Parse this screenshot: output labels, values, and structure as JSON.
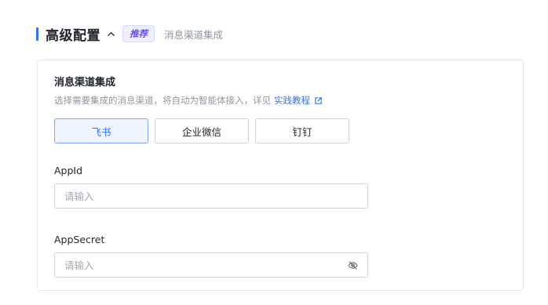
{
  "header": {
    "title": "高级配置",
    "badge": "推荐",
    "subtitle": "消息渠道集成",
    "accent_color": "#3370ff",
    "collapse_icon": "chevron-up-icon"
  },
  "card": {
    "title": "消息渠道集成",
    "description": "选择需要集成的消息渠道，将自动为智能体接入，详见",
    "link_text": "实践教程",
    "link_icon": "external-link-icon",
    "link_color": "#3370ff"
  },
  "channels": [
    {
      "label": "飞书",
      "selected": true
    },
    {
      "label": "企业微信",
      "selected": false
    },
    {
      "label": "钉钉",
      "selected": false
    }
  ],
  "fields": {
    "app_id": {
      "label": "AppId",
      "placeholder": "请输入",
      "value": ""
    },
    "app_secret": {
      "label": "AppSecret",
      "placeholder": "请输入",
      "value": "",
      "toggle_icon": "eye-off-icon"
    }
  }
}
